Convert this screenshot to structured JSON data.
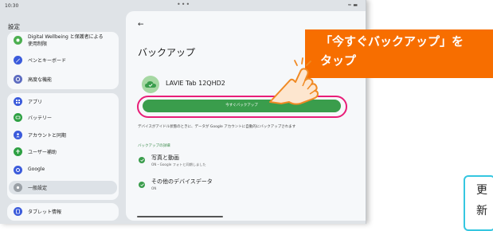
{
  "status_bar": {
    "time": "10:30",
    "dots": "•••",
    "icons": "≈ ▬"
  },
  "sidebar": {
    "title": "設定",
    "items": [
      {
        "label": "Digital Wellbeing と保護者による",
        "label2": "使用制限",
        "icon": "wellbeing-icon",
        "color": "#4caf50"
      },
      {
        "label": "ペンとキーボード",
        "icon": "pen-icon",
        "color": "#3b5bdb"
      },
      {
        "label": "高度な機能",
        "icon": "gear-icon",
        "color": "#5c6bc0"
      },
      {
        "label": "アプリ",
        "icon": "apps-icon",
        "color": "#3b5bdb"
      },
      {
        "label": "バッテリー",
        "icon": "battery-icon",
        "color": "#2ea043"
      },
      {
        "label": "アカウントと同期",
        "icon": "account-icon",
        "color": "#3b5bdb"
      },
      {
        "label": "ユーザー補助",
        "icon": "accessibility-icon",
        "color": "#2ea043"
      },
      {
        "label": "Google",
        "icon": "google-icon",
        "color": "#3b5bdb"
      },
      {
        "label": "一般設定",
        "icon": "settings-icon",
        "color": "#9aa0a6",
        "selected": true
      },
      {
        "label": "タブレット情報",
        "icon": "tablet-icon",
        "color": "#3b5bdb"
      }
    ]
  },
  "content": {
    "back": "←",
    "title": "バックアップ",
    "device_name": "LAVIE Tab 12QHD2",
    "backup_button": "今すぐバックアップ",
    "description": "デバイスがアイドル状態のときに、データが Google アカウントに自動的にバックアップされます",
    "section_label": "バックアップの詳細",
    "rows": [
      {
        "title": "写真と動画",
        "subtitle": "ON・Google フォトと同期しました"
      },
      {
        "title": "その他のデバイスデータ",
        "subtitle": "ON"
      }
    ]
  },
  "callout": {
    "line1": "「今すぐバックアップ」を",
    "line2": "タップ"
  },
  "bottom_box": {
    "line1": "更",
    "line2": "新"
  },
  "colors": {
    "accent_green": "#3a9d4c",
    "highlight": "#e81e78",
    "callout": "#f76e00",
    "box_border": "#35c6e0"
  }
}
